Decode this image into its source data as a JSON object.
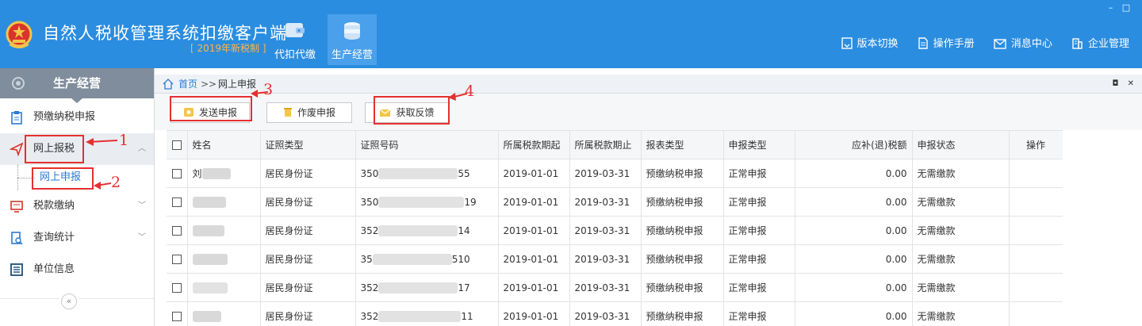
{
  "header": {
    "title": "自然人税收管理系统扣缴客户端",
    "subtitle": "[ 2019年新税制 ]",
    "nav": [
      {
        "label": "代扣代缴",
        "active": false
      },
      {
        "label": "生产经营",
        "active": true
      }
    ],
    "window_controls": {
      "minimize": "–",
      "maximize": "□"
    },
    "top_links": [
      {
        "label": "版本切换",
        "icon": "version-switch-icon"
      },
      {
        "label": "操作手册",
        "icon": "manual-icon"
      },
      {
        "label": "消息中心",
        "icon": "message-icon"
      },
      {
        "label": "企业管理",
        "icon": "enterprise-icon"
      }
    ]
  },
  "sidebar": {
    "title": "生产经营",
    "items": [
      {
        "label": "预缴纳税申报",
        "icon": "clipboard-icon"
      },
      {
        "label": "网上报税",
        "icon": "send-icon",
        "expanded": true
      },
      {
        "label": "网上申报",
        "sub": true
      },
      {
        "label": "税款缴纳",
        "icon": "tax-payment-icon"
      },
      {
        "label": "查询统计",
        "icon": "query-icon"
      },
      {
        "label": "单位信息",
        "icon": "unit-info-icon"
      }
    ],
    "collapse_glyph": "«"
  },
  "breadcrumb": {
    "home": "首页",
    "separator": ">>",
    "current": "网上申报"
  },
  "toolbar": {
    "send": "发送申报",
    "void": "作废申报",
    "feedback": "获取反馈"
  },
  "table": {
    "columns": [
      "姓名",
      "证照类型",
      "证照号码",
      "所属税款期起",
      "所属税款期止",
      "报表类型",
      "申报类型",
      "应补(退)税额",
      "申报状态",
      "操作"
    ],
    "rows": [
      {
        "name": "刘",
        "id_type": "居民身份证",
        "id_prefix": "350",
        "id_suffix": "55",
        "start": "2019-01-01",
        "end": "2019-03-31",
        "report_type": "预缴纳税申报",
        "decl_type": "正常申报",
        "amount": "0.00",
        "status": "无需缴款",
        "op": ""
      },
      {
        "name": "",
        "id_type": "居民身份证",
        "id_prefix": "350",
        "id_suffix": "19",
        "start": "2019-01-01",
        "end": "2019-03-31",
        "report_type": "预缴纳税申报",
        "decl_type": "正常申报",
        "amount": "0.00",
        "status": "无需缴款",
        "op": ""
      },
      {
        "name": "",
        "id_type": "居民身份证",
        "id_prefix": "352",
        "id_suffix": "14",
        "start": "2019-01-01",
        "end": "2019-03-31",
        "report_type": "预缴纳税申报",
        "decl_type": "正常申报",
        "amount": "0.00",
        "status": "无需缴款",
        "op": ""
      },
      {
        "name": "",
        "id_type": "居民身份证",
        "id_prefix": "35",
        "id_suffix": "510",
        "start": "2019-01-01",
        "end": "2019-03-31",
        "report_type": "预缴纳税申报",
        "decl_type": "正常申报",
        "amount": "0.00",
        "status": "无需缴款",
        "op": ""
      },
      {
        "name": "",
        "id_type": "居民身份证",
        "id_prefix": "352",
        "id_suffix": "17",
        "start": "2019-01-01",
        "end": "2019-03-31",
        "report_type": "预缴纳税申报",
        "decl_type": "正常申报",
        "amount": "0.00",
        "status": "无需缴款",
        "op": ""
      },
      {
        "name": "",
        "id_type": "居民身份证",
        "id_prefix": "352",
        "id_suffix": "11",
        "start": "2019-01-01",
        "end": "2019-03-31",
        "report_type": "预缴纳税申报",
        "decl_type": "正常申报",
        "amount": "0.00",
        "status": "无需缴款",
        "op": ""
      }
    ]
  },
  "annotations": [
    "1",
    "2",
    "3",
    "4"
  ],
  "colors": {
    "header_bg": "#2b8de0",
    "subtitle": "#ffb347",
    "sidebar_head": "#7f8d9c",
    "link": "#2b7bd0",
    "annotation_red": "#e53030"
  }
}
